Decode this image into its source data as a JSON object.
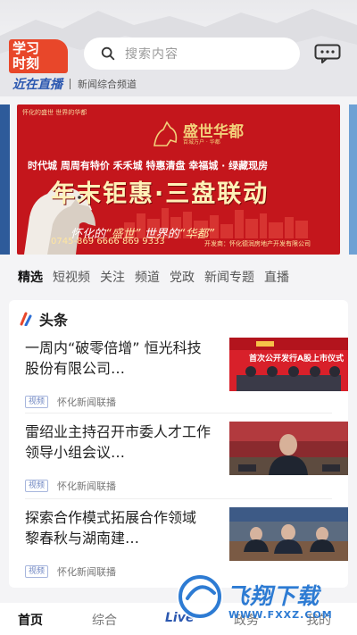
{
  "header": {
    "logo_line1": "学习",
    "logo_line2": "时刻",
    "search_placeholder": "搜索内容",
    "brand_name": "近在直播",
    "brand_sub": "新闻综合频道"
  },
  "banner": {
    "top_small": "怀化的盛世 世界的华都",
    "brand_name": "盛世华都",
    "brand_sub": "百城万户 · 华都",
    "promo_line": "时代城 周周有特价  禾禾城 特惠清盘  幸福城 · 绿藏现房",
    "headline": "年末钜惠·三盘联动",
    "slogan_pre": "怀化的",
    "slogan_q1": "“盛世”",
    "slogan_mid": " 世界的",
    "slogan_q2": "“华都”",
    "phone": "0745-869 6666 869 9333",
    "developer": "开发商：怀化德润房地产开发有限公司"
  },
  "tabs": [
    "精选",
    "短视频",
    "关注",
    "频道",
    "党政",
    "新闻专题",
    "直播"
  ],
  "section": {
    "title": "头条",
    "accent": "#e8472a"
  },
  "news": [
    {
      "title": "一周内“破零倍增” 恒光科技股份有限公司…",
      "tag": "视频",
      "source": "怀化新闻联播",
      "thumb_caption": "首次公开发行A股上市仪式"
    },
    {
      "title": "雷绍业主持召开市委人才工作领导小组会议…",
      "tag": "视频",
      "source": "怀化新闻联播"
    },
    {
      "title": "探索合作模式拓展合作领域 黎春秋与湖南建…",
      "tag": "视频",
      "source": "怀化新闻联播"
    }
  ],
  "bottom_nav": [
    "首页",
    "综合",
    "Live",
    "政务",
    "我的"
  ],
  "watermark": {
    "text": "飞翔下载",
    "url": "WWW.FXXZ.COM"
  },
  "colors": {
    "brand_red": "#e8472a",
    "link_blue": "#2c58b0",
    "banner_red": "#c4161c"
  }
}
